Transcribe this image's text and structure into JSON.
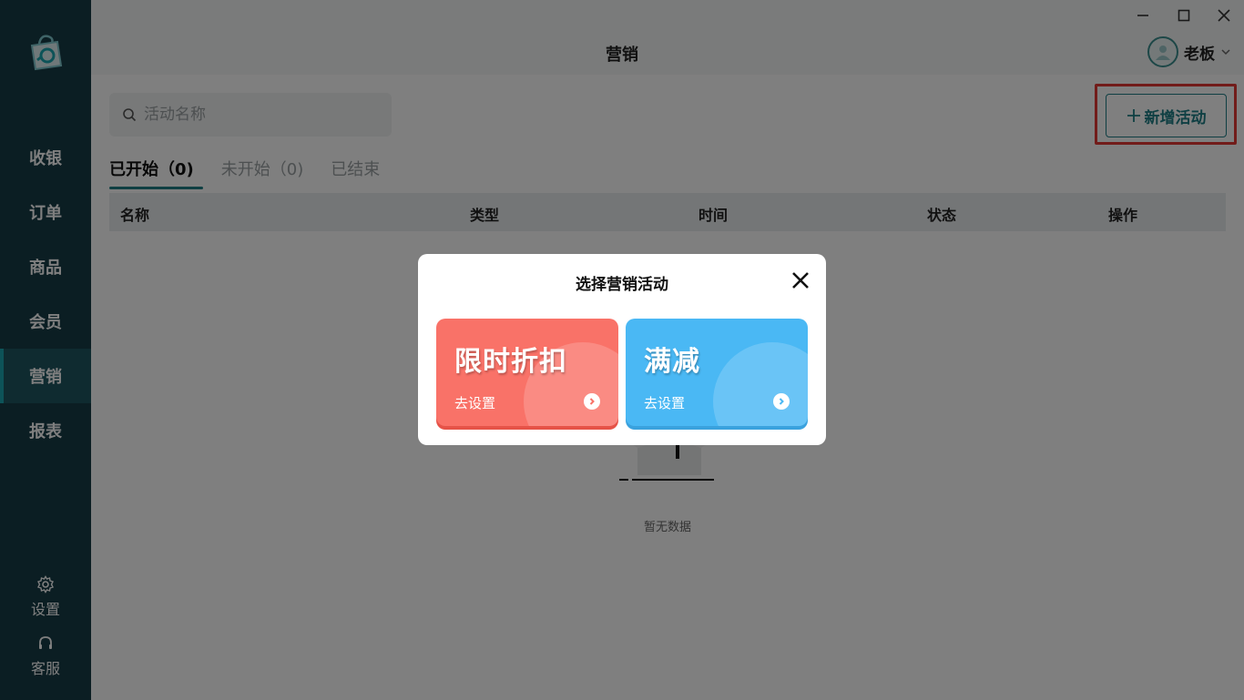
{
  "window": {
    "title": "营销"
  },
  "sidebar": {
    "items": [
      {
        "label": "收银"
      },
      {
        "label": "订单"
      },
      {
        "label": "商品"
      },
      {
        "label": "会员"
      },
      {
        "label": "营销",
        "active": true
      },
      {
        "label": "报表"
      }
    ],
    "settings_label": "设置",
    "service_label": "客服"
  },
  "header": {
    "user_name": "老板"
  },
  "main": {
    "search_placeholder": "活动名称",
    "add_button_label": "新增活动",
    "tabs": [
      {
        "label": "已开始（0)"
      },
      {
        "label": "未开始（0)"
      },
      {
        "label": "已结束"
      }
    ],
    "columns": [
      "名称",
      "类型",
      "时间",
      "状态",
      "操作"
    ],
    "empty_text": "暂无数据"
  },
  "modal": {
    "title": "选择营销活动",
    "cards": [
      {
        "title": "限时折扣",
        "action": "去设置",
        "color": "#f97268"
      },
      {
        "title": "满减",
        "action": "去设置",
        "color": "#4ab8f4"
      }
    ]
  },
  "colors": {
    "sidebar": "#163d47",
    "accent": "#1f7f86",
    "highlight": "#e53935"
  }
}
